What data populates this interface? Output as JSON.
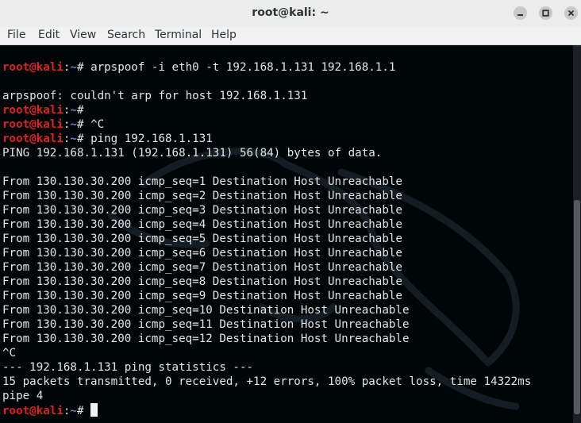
{
  "window": {
    "title": "root@kali: ~",
    "buttons": {
      "minimize": "minimize-icon",
      "maximize": "maximize-icon",
      "close": "close-icon"
    }
  },
  "menu": [
    "File",
    "Edit",
    "View",
    "Search",
    "Terminal",
    "Help"
  ],
  "prompt": {
    "user": "root@kali",
    "sep": ":",
    "path": "~",
    "symbol": "# "
  },
  "lines": [
    {
      "type": "prompt",
      "cmd": "arpspoof -i eth0 -t 192.168.1.131 192.168.1.1"
    },
    {
      "type": "text",
      "text": ""
    },
    {
      "type": "text",
      "text": "arpspoof: couldn't arp for host 192.168.1.131"
    },
    {
      "type": "prompt",
      "cmd": ""
    },
    {
      "type": "prompt",
      "cmd": "^C"
    },
    {
      "type": "prompt",
      "cmd": "ping 192.168.1.131"
    },
    {
      "type": "text",
      "text": "PING 192.168.1.131 (192.168.1.131) 56(84) bytes of data."
    },
    {
      "type": "text",
      "text": ""
    },
    {
      "type": "text",
      "text": "From 130.130.30.200 icmp_seq=1 Destination Host Unreachable"
    },
    {
      "type": "text",
      "text": "From 130.130.30.200 icmp_seq=2 Destination Host Unreachable"
    },
    {
      "type": "text",
      "text": "From 130.130.30.200 icmp_seq=3 Destination Host Unreachable"
    },
    {
      "type": "text",
      "text": "From 130.130.30.200 icmp_seq=4 Destination Host Unreachable"
    },
    {
      "type": "text",
      "text": "From 130.130.30.200 icmp_seq=5 Destination Host Unreachable"
    },
    {
      "type": "text",
      "text": "From 130.130.30.200 icmp_seq=6 Destination Host Unreachable"
    },
    {
      "type": "text",
      "text": "From 130.130.30.200 icmp_seq=7 Destination Host Unreachable"
    },
    {
      "type": "text",
      "text": "From 130.130.30.200 icmp_seq=8 Destination Host Unreachable"
    },
    {
      "type": "text",
      "text": "From 130.130.30.200 icmp_seq=9 Destination Host Unreachable"
    },
    {
      "type": "text",
      "text": "From 130.130.30.200 icmp_seq=10 Destination Host Unreachable"
    },
    {
      "type": "text",
      "text": "From 130.130.30.200 icmp_seq=11 Destination Host Unreachable"
    },
    {
      "type": "text",
      "text": "From 130.130.30.200 icmp_seq=12 Destination Host Unreachable"
    },
    {
      "type": "text",
      "text": "^C"
    },
    {
      "type": "text",
      "text": "--- 192.168.1.131 ping statistics ---"
    },
    {
      "type": "text",
      "text": "15 packets transmitted, 0 received, +12 errors, 100% packet loss, time 14322ms"
    },
    {
      "type": "text",
      "text": "pipe 4"
    },
    {
      "type": "prompt",
      "cmd": "",
      "cursor": true
    }
  ],
  "colors": {
    "terminal_bg": "#000508",
    "prompt_user": "#e0211c",
    "prompt_path": "#5c84c4",
    "text": "#e5e5e5"
  }
}
